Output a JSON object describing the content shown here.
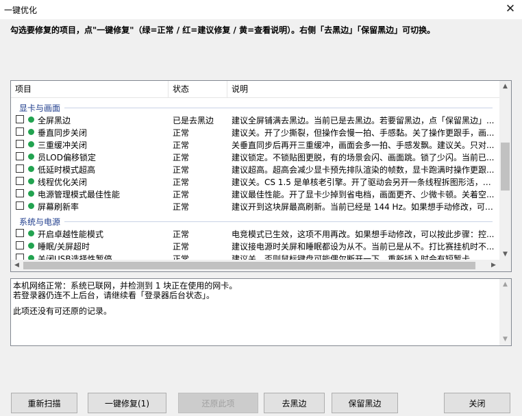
{
  "window": {
    "title": "一键优化"
  },
  "instruction": "勾选要修复的项目，点\"一键修复\"（绿=正常 / 红=建议修复 / 黄=查看说明）。右侧「去黑边」「保留黑边」可切换。",
  "list": {
    "columns": {
      "item": "项目",
      "status": "状态",
      "desc": "说明"
    },
    "groups": [
      {
        "name": "显卡与画面",
        "rows": [
          {
            "name": "全屏黑边",
            "status": "已是去黑边",
            "desc": "建议全屏铺满去黑边。当前已是去黑边。若要留黑边，点「保留黑边」..."
          },
          {
            "name": "垂直同步关闭",
            "status": "正常",
            "desc": "建议关。开了少撕裂，但操作会慢一拍、手感黏。关了操作更跟手，画..."
          },
          {
            "name": "三重缓冲关闭",
            "status": "正常",
            "desc": "关垂直同步后再开三重缓冲，画面会多一拍、手感发飘。建议关。只对..."
          },
          {
            "name": "员LOD偏移锁定",
            "status": "正常",
            "desc": "建议锁定。不锁贴图更脱，有的场景会闪、画面跳。锁了少闪。当前已..."
          },
          {
            "name": "低延时模式超高",
            "status": "正常",
            "desc": "建议超高。超高会减少显卡预先排队渲染的帧数，显卡跑满时操作更跟..."
          },
          {
            "name": "线程优化关闭",
            "status": "正常",
            "desc": "建议关。CS 1.5 是单核老引擎。开了驱动会另开一条线程拆图形活，容..."
          },
          {
            "name": "电源管理模式最佳性能",
            "status": "正常",
            "desc": "建议最佳性能。开了显卡少掉到省电档，画面更齐、少微卡顿。关着空..."
          },
          {
            "name": "屏幕刷新率",
            "status": "正常",
            "desc": "建议开到这块屏最高刷新。当前已经是 144 Hz。如果想手动修改，可以..."
          }
        ]
      },
      {
        "name": "系统与电源",
        "rows": [
          {
            "name": "开启卓越性能模式",
            "status": "正常",
            "desc": "电竞模式已生效，这项不用再改。如果想手动修改，可以按此步骤：控..."
          },
          {
            "name": "睡眠/关屏超时",
            "status": "正常",
            "desc": "建议接电源时关屏和睡眠都设为从不。当前已是从不。打比赛挂机时不..."
          },
          {
            "name": "关闭USB选择性暂停",
            "status": "正常",
            "desc": "建议关。否则鼠标键盘可能偶尔断开一下，重新插入时会有短暂卡..."
          }
        ]
      }
    ]
  },
  "info": {
    "lines": [
      "本机网络正常：系统已联网，并检测到 1 块正在使用的网卡。",
      "若登录器仍连不上后台，请继续看「登录器后台状态」。",
      "",
      "此项还没有可还原的记录。"
    ]
  },
  "buttons": {
    "rescan": "重新扫描",
    "fix_all": "一键修复(1)",
    "restore": "还原此项",
    "remove_black": "去黑边",
    "keep_black": "保留黑边",
    "close": "关闭"
  },
  "colors": {
    "status_ok": "#22a350",
    "group_label": "#1e3c8c"
  }
}
